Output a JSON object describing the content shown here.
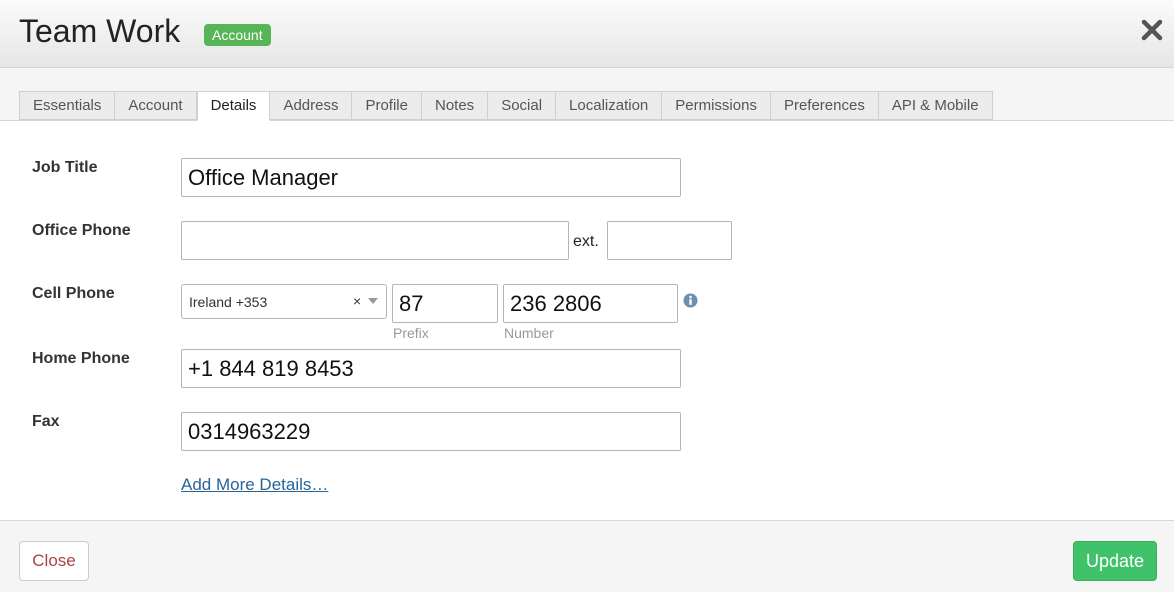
{
  "header": {
    "title": "Team Work",
    "badge": "Account",
    "close_icon": "close-icon"
  },
  "tabs": [
    {
      "label": "Essentials"
    },
    {
      "label": "Account"
    },
    {
      "label": "Details",
      "active": true
    },
    {
      "label": "Address"
    },
    {
      "label": "Profile"
    },
    {
      "label": "Notes"
    },
    {
      "label": "Social"
    },
    {
      "label": "Localization"
    },
    {
      "label": "Permissions"
    },
    {
      "label": "Preferences"
    },
    {
      "label": "API & Mobile"
    }
  ],
  "form": {
    "job_title": {
      "label": "Job Title",
      "value": "Office Manager"
    },
    "office_phone": {
      "label": "Office Phone",
      "value": "",
      "ext_label": "ext.",
      "ext_value": ""
    },
    "cell_phone": {
      "label": "Cell Phone",
      "country": "Ireland +353",
      "clear": "×",
      "prefix": "87",
      "prefix_hint": "Prefix",
      "number": "236 2806",
      "number_hint": "Number",
      "info_icon": "info-icon"
    },
    "home_phone": {
      "label": "Home Phone",
      "value": "+1 844 819 8453"
    },
    "fax": {
      "label": "Fax",
      "value": "0314963229"
    },
    "add_more": "Add More Details…"
  },
  "footer": {
    "close_label": "Close",
    "update_label": "Update"
  },
  "colors": {
    "badge": "#56b556",
    "update_button": "#3fc26a",
    "close_text": "#a94442",
    "link": "#2a6496"
  }
}
